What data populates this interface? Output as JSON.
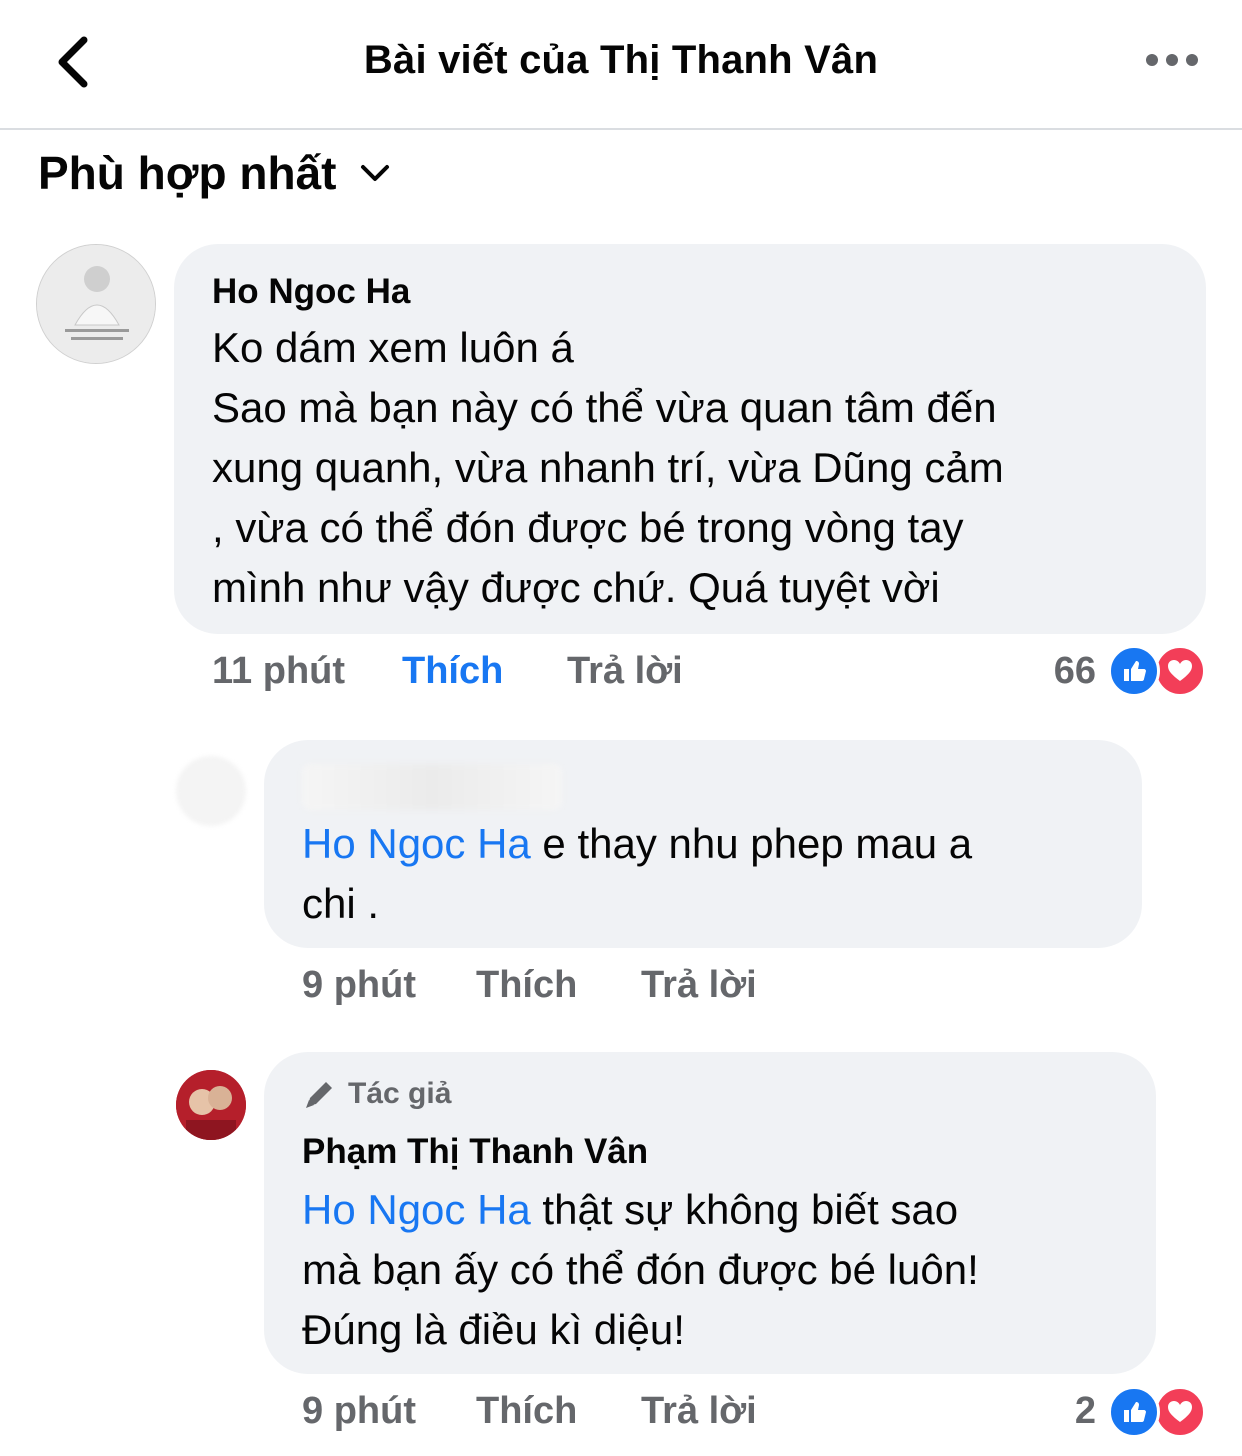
{
  "header": {
    "title": "Bài viết của Thị Thanh Vân"
  },
  "sort": {
    "label": "Phù hợp nhất"
  },
  "comments": [
    {
      "author": "Ho Ngoc Ha",
      "lines": [
        "Ko dám xem luôn á",
        "Sao mà bạn này có thể vừa quan tâm đến",
        "xung quanh, vừa nhanh trí, vừa Dũng cảm",
        ", vừa có thể đón được bé trong vòng tay",
        "mình như vậy được chứ. Quá tuyệt vời"
      ],
      "time": "11 phút",
      "like_label": "Thích",
      "reply_label": "Trả lời",
      "reactions_count": "66"
    },
    {
      "mention": "Ho Ngoc Ha",
      "line1_rest": " e thay nhu phep mau a",
      "line2": "chi .",
      "time": "9 phút",
      "like_label": "Thích",
      "reply_label": "Trả lời"
    },
    {
      "badge": "Tác giả",
      "author": "Phạm Thị Thanh Vân",
      "mention": "Ho Ngoc Ha",
      "line1_rest": " thật sự không biết sao",
      "line2": "mà bạn ấy có thể đón được bé luôn!",
      "line3": "Đúng là điều kì diệu!",
      "time": "9 phút",
      "like_label": "Thích",
      "reply_label": "Trả lời",
      "reactions_count": "2"
    }
  ],
  "colors": {
    "accent": "#1877f2",
    "bubble": "#f0f2f5",
    "muted": "#65676b",
    "love": "#f33e58"
  },
  "icons": [
    "back-arrow-icon",
    "more-dots-icon",
    "chevron-down-icon",
    "like-reaction-icon",
    "love-reaction-icon",
    "pencil-icon"
  ]
}
